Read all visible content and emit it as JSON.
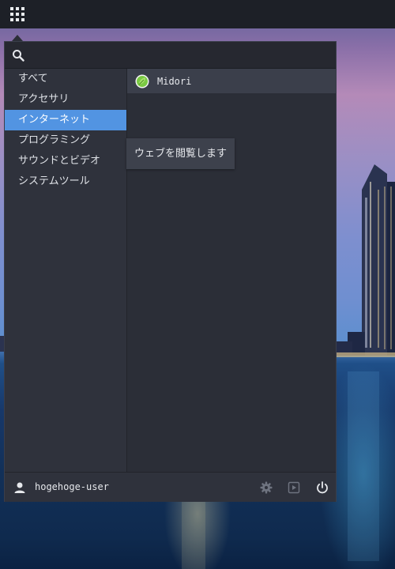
{
  "panel": {
    "apps_button_icon": "app-grid-icon"
  },
  "menu": {
    "search": {
      "icon": "search-icon",
      "value": "",
      "placeholder": ""
    },
    "categories": [
      {
        "label": "すべて",
        "selected": false
      },
      {
        "label": "アクセサリ",
        "selected": false
      },
      {
        "label": "インターネット",
        "selected": true
      },
      {
        "label": "プログラミング",
        "selected": false
      },
      {
        "label": "サウンドとビデオ",
        "selected": false
      },
      {
        "label": "システムツール",
        "selected": false
      }
    ],
    "apps": [
      {
        "label": "Midori",
        "icon": "midori-leaf-icon"
      }
    ],
    "tooltip": "ウェブを閲覧します",
    "footer": {
      "user_icon": "user-icon",
      "user_name": "hogehoge-user",
      "buttons": [
        "settings-icon",
        "screensaver-icon",
        "power-icon"
      ]
    }
  },
  "colors": {
    "accent": "#5294e2",
    "panel_bg": "#1d2027",
    "menu_bg": "#2f323c"
  }
}
